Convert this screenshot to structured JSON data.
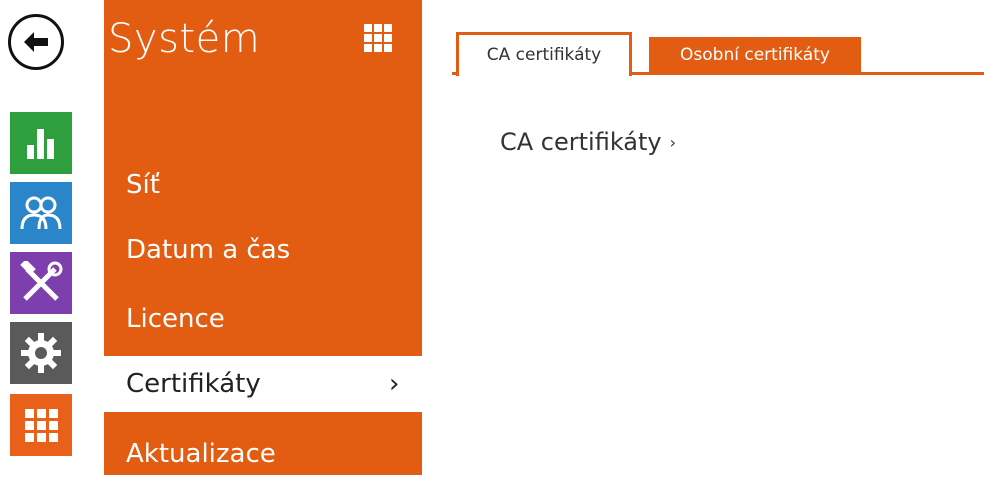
{
  "menu": {
    "title": "Systém",
    "items": [
      {
        "label": "Síť"
      },
      {
        "label": "Datum a čas"
      },
      {
        "label": "Licence"
      },
      {
        "label": "Certifikáty",
        "chevron": "›"
      },
      {
        "label": "Aktualizace"
      }
    ]
  },
  "rail": {
    "icons": [
      "back-arrow-icon",
      "stats-icon",
      "users-icon",
      "tools-icon",
      "settings-gear-icon",
      "apps-grid-icon"
    ]
  },
  "tabs": [
    {
      "label": "CA certifikáty",
      "active": true
    },
    {
      "label": "Osobní certifikáty",
      "active": false
    }
  ],
  "content": {
    "section_link": "CA certifikáty",
    "section_chevron": "›"
  },
  "colors": {
    "accent": "#e25d12",
    "stats": "#2f9e3c",
    "users": "#2a86c8",
    "tools": "#7e3fae",
    "settings": "#5a5a5a",
    "apps": "#e8601a"
  }
}
